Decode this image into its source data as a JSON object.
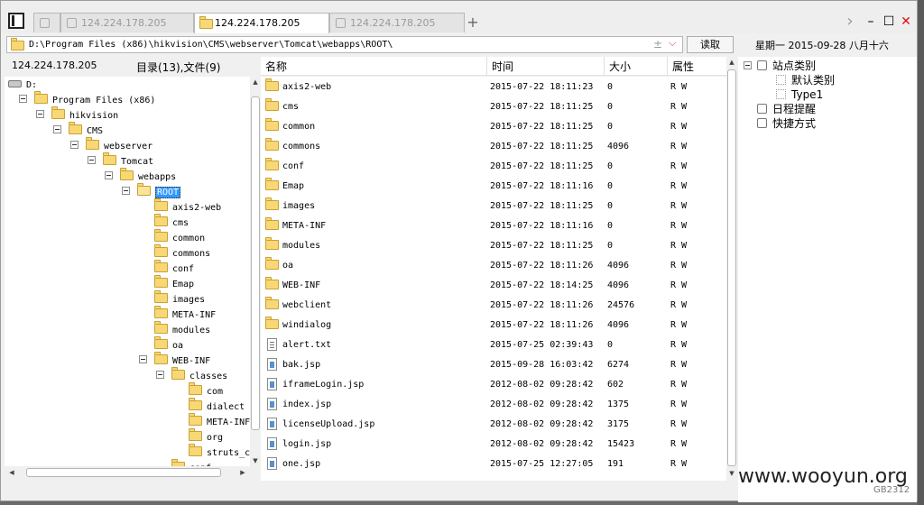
{
  "tabs": [
    {
      "label": "",
      "active": false
    },
    {
      "label": "124.224.178.205",
      "active": false
    },
    {
      "label": "124.224.178.205",
      "active": true
    },
    {
      "label": "124.224.178.205",
      "active": false
    }
  ],
  "tab_add": "+",
  "window_controls": {
    "nav": "›",
    "minimize": "–",
    "maximize": "☐",
    "close": "✕"
  },
  "address": {
    "path": "D:\\Program Files (x86)\\hikvision\\CMS\\webserver\\Tomcat\\webapps\\ROOT\\",
    "read_label": "读取",
    "date_text": "星期一 2015-09-28 八月十六"
  },
  "left_header": {
    "host": "124.224.178.205",
    "summary": "目录(13),文件(9)"
  },
  "tree": [
    {
      "label": "D:",
      "depth": 0,
      "icon": "drive",
      "expander": false
    },
    {
      "label": "Program Files (x86)",
      "depth": 1,
      "icon": "folder",
      "expander": true
    },
    {
      "label": "hikvision",
      "depth": 2,
      "icon": "folder",
      "expander": true
    },
    {
      "label": "CMS",
      "depth": 3,
      "icon": "folder",
      "expander": true
    },
    {
      "label": "webserver",
      "depth": 4,
      "icon": "folder",
      "expander": true
    },
    {
      "label": "Tomcat",
      "depth": 5,
      "icon": "folder",
      "expander": true
    },
    {
      "label": "webapps",
      "depth": 6,
      "icon": "folder",
      "expander": true
    },
    {
      "label": "ROOT",
      "depth": 7,
      "icon": "folder-open",
      "expander": true,
      "selected": true
    },
    {
      "label": "axis2-web",
      "depth": 8,
      "icon": "folder",
      "expander": false
    },
    {
      "label": "cms",
      "depth": 8,
      "icon": "folder",
      "expander": false
    },
    {
      "label": "common",
      "depth": 8,
      "icon": "folder",
      "expander": false
    },
    {
      "label": "commons",
      "depth": 8,
      "icon": "folder",
      "expander": false
    },
    {
      "label": "conf",
      "depth": 8,
      "icon": "folder",
      "expander": false
    },
    {
      "label": "Emap",
      "depth": 8,
      "icon": "folder",
      "expander": false
    },
    {
      "label": "images",
      "depth": 8,
      "icon": "folder",
      "expander": false
    },
    {
      "label": "META-INF",
      "depth": 8,
      "icon": "folder",
      "expander": false
    },
    {
      "label": "modules",
      "depth": 8,
      "icon": "folder",
      "expander": false
    },
    {
      "label": "oa",
      "depth": 8,
      "icon": "folder",
      "expander": false
    },
    {
      "label": "WEB-INF",
      "depth": 8,
      "icon": "folder",
      "expander": true
    },
    {
      "label": "classes",
      "depth": 9,
      "icon": "folder",
      "expander": true
    },
    {
      "label": "com",
      "depth": 10,
      "icon": "folder",
      "expander": false
    },
    {
      "label": "dialect",
      "depth": 10,
      "icon": "folder",
      "expander": false
    },
    {
      "label": "META-INF",
      "depth": 10,
      "icon": "folder",
      "expander": false
    },
    {
      "label": "org",
      "depth": 10,
      "icon": "folder",
      "expander": false
    },
    {
      "label": "struts_c",
      "depth": 10,
      "icon": "folder",
      "expander": false
    },
    {
      "label": "conf",
      "depth": 9,
      "icon": "folder",
      "expander": false
    }
  ],
  "columns": {
    "name": "名称",
    "time": "时间",
    "size": "大小",
    "attr": "属性"
  },
  "files": [
    {
      "name": "axis2-web",
      "time": "2015-07-22 18:11:23",
      "size": "0",
      "attr": "R W",
      "type": "folder"
    },
    {
      "name": "cms",
      "time": "2015-07-22 18:11:25",
      "size": "0",
      "attr": "R W",
      "type": "folder"
    },
    {
      "name": "common",
      "time": "2015-07-22 18:11:25",
      "size": "0",
      "attr": "R W",
      "type": "folder"
    },
    {
      "name": "commons",
      "time": "2015-07-22 18:11:25",
      "size": "4096",
      "attr": "R W",
      "type": "folder"
    },
    {
      "name": "conf",
      "time": "2015-07-22 18:11:25",
      "size": "0",
      "attr": "R W",
      "type": "folder"
    },
    {
      "name": "Emap",
      "time": "2015-07-22 18:11:16",
      "size": "0",
      "attr": "R W",
      "type": "folder"
    },
    {
      "name": "images",
      "time": "2015-07-22 18:11:25",
      "size": "0",
      "attr": "R W",
      "type": "folder"
    },
    {
      "name": "META-INF",
      "time": "2015-07-22 18:11:16",
      "size": "0",
      "attr": "R W",
      "type": "folder"
    },
    {
      "name": "modules",
      "time": "2015-07-22 18:11:25",
      "size": "0",
      "attr": "R W",
      "type": "folder"
    },
    {
      "name": "oa",
      "time": "2015-07-22 18:11:26",
      "size": "4096",
      "attr": "R W",
      "type": "folder"
    },
    {
      "name": "WEB-INF",
      "time": "2015-07-22 18:14:25",
      "size": "4096",
      "attr": "R W",
      "type": "folder"
    },
    {
      "name": "webclient",
      "time": "2015-07-22 18:11:26",
      "size": "24576",
      "attr": "R W",
      "type": "folder"
    },
    {
      "name": "windialog",
      "time": "2015-07-22 18:11:26",
      "size": "4096",
      "attr": "R W",
      "type": "folder"
    },
    {
      "name": "alert.txt",
      "time": "2015-07-25 02:39:43",
      "size": "0",
      "attr": "R W",
      "type": "txt"
    },
    {
      "name": "bak.jsp",
      "time": "2015-09-28 16:03:42",
      "size": "6274",
      "attr": "R W",
      "type": "jsp"
    },
    {
      "name": "iframeLogin.jsp",
      "time": "2012-08-02 09:28:42",
      "size": "602",
      "attr": "R W",
      "type": "jsp"
    },
    {
      "name": "index.jsp",
      "time": "2012-08-02 09:28:42",
      "size": "1375",
      "attr": "R W",
      "type": "jsp"
    },
    {
      "name": "licenseUpload.jsp",
      "time": "2012-08-02 09:28:42",
      "size": "3175",
      "attr": "R W",
      "type": "jsp"
    },
    {
      "name": "login.jsp",
      "time": "2012-08-02 09:28:42",
      "size": "15423",
      "attr": "R W",
      "type": "jsp"
    },
    {
      "name": "one.jsp",
      "time": "2015-07-25 12:27:05",
      "size": "191",
      "attr": "R W",
      "type": "jsp"
    }
  ],
  "right_tree": [
    {
      "label": "站点类别",
      "depth": 0,
      "icon": "category-icon",
      "expander": true
    },
    {
      "label": "默认类别",
      "depth": 1,
      "icon": "checkbox",
      "expander": false
    },
    {
      "label": "Type1",
      "depth": 1,
      "icon": "checkbox",
      "expander": false
    },
    {
      "label": "日程提醒",
      "depth": 0,
      "icon": "calendar-icon",
      "expander": false
    },
    {
      "label": "快捷方式",
      "depth": 0,
      "icon": "shortcut-icon",
      "expander": false
    }
  ],
  "watermark": "www.wooyun.org",
  "watermark_id": "GB2312"
}
